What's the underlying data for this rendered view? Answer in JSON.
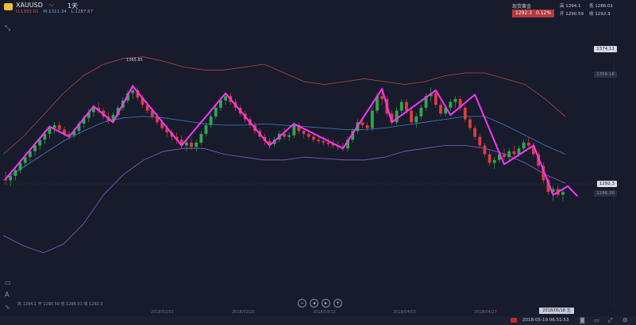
{
  "header": {
    "symbol": "XAUUSD",
    "period": "1天",
    "legend": {
      "upper": "U:1393.01",
      "middle": "M:1311.34",
      "lower": "L:1287.67"
    }
  },
  "quote": {
    "title": "现货黄金",
    "price": "1292.3",
    "change_pct": "0.12%",
    "high": "高 1294.1",
    "low": "低 1286.01",
    "open": "开 1290.59",
    "close": "收 1292.3"
  },
  "price_axis": {
    "level_top": "1374.11",
    "level_mid": "1358.16",
    "current": "1292.3",
    "current_low": "1286.36"
  },
  "peak_annotation": "1365.85",
  "bottom_info": "高 1294.1 开 1290.59 低 1286.01 收 1292.3",
  "x_axis": [
    "2018/02/01",
    "2018/02/20",
    "2018/03/13",
    "2018/04/03",
    "2018/04/27"
  ],
  "cursor_date": "2018/05/18 五",
  "status_time": "2018-05-19 06:51:53",
  "icons": {
    "settings_tool": "crosshair-expand-icon",
    "ruler": "ruler-icon",
    "text": "text-annotation-icon",
    "wave": "wave-icon",
    "zoom_out": "zoom-out-icon",
    "prev": "step-back-icon",
    "next": "step-forward-icon",
    "zoom_in": "zoom-in-icon"
  },
  "colors": {
    "up": "#2fa84f",
    "down": "#d93f3f",
    "boll_upper": "#b04a4a",
    "boll_mid": "#3f7fd0",
    "boll_lower": "#8a5cd6",
    "zigzag": "#ff33ff",
    "background": "#171b2b"
  },
  "chart_data": {
    "type": "candlestick",
    "title": "",
    "ylim": [
      1244,
      1386
    ],
    "x_range_dates": [
      "2018/01/03",
      "2018/05/18"
    ],
    "candles": [
      [
        1301,
        1306,
        1297,
        1300
      ],
      [
        1300,
        1305,
        1296,
        1303
      ],
      [
        1303,
        1309,
        1300,
        1307
      ],
      [
        1307,
        1314,
        1305,
        1312
      ],
      [
        1312,
        1318,
        1309,
        1316
      ],
      [
        1316,
        1322,
        1313,
        1320
      ],
      [
        1320,
        1326,
        1317,
        1324
      ],
      [
        1324,
        1330,
        1321,
        1328
      ],
      [
        1328,
        1334,
        1325,
        1332
      ],
      [
        1332,
        1338,
        1329,
        1336
      ],
      [
        1336,
        1340,
        1332,
        1338
      ],
      [
        1338,
        1340,
        1333,
        1335
      ],
      [
        1335,
        1337,
        1330,
        1332
      ],
      [
        1332,
        1334,
        1328,
        1331
      ],
      [
        1331,
        1336,
        1329,
        1334
      ],
      [
        1334,
        1341,
        1332,
        1339
      ],
      [
        1339,
        1345,
        1336,
        1343
      ],
      [
        1343,
        1349,
        1340,
        1347
      ],
      [
        1347,
        1352,
        1344,
        1350
      ],
      [
        1350,
        1354,
        1346,
        1348
      ],
      [
        1348,
        1350,
        1342,
        1344
      ],
      [
        1344,
        1347,
        1339,
        1341
      ],
      [
        1341,
        1347,
        1339,
        1345
      ],
      [
        1345,
        1352,
        1343,
        1350
      ],
      [
        1350,
        1357,
        1348,
        1355
      ],
      [
        1355,
        1362,
        1353,
        1360
      ],
      [
        1360,
        1366,
        1356,
        1362
      ],
      [
        1362,
        1364,
        1355,
        1357
      ],
      [
        1357,
        1359,
        1350,
        1352
      ],
      [
        1352,
        1354,
        1346,
        1348
      ],
      [
        1348,
        1350,
        1342,
        1344
      ],
      [
        1344,
        1346,
        1338,
        1340
      ],
      [
        1340,
        1342,
        1334,
        1336
      ],
      [
        1336,
        1338,
        1330,
        1333
      ],
      [
        1333,
        1335,
        1327,
        1330
      ],
      [
        1330,
        1333,
        1325,
        1328
      ],
      [
        1328,
        1331,
        1322,
        1324
      ],
      [
        1324,
        1328,
        1320,
        1326
      ],
      [
        1326,
        1329,
        1321,
        1323
      ],
      [
        1323,
        1328,
        1320,
        1326
      ],
      [
        1326,
        1334,
        1324,
        1332
      ],
      [
        1332,
        1340,
        1330,
        1338
      ],
      [
        1338,
        1346,
        1336,
        1344
      ],
      [
        1344,
        1352,
        1342,
        1350
      ],
      [
        1350,
        1357,
        1348,
        1355
      ],
      [
        1355,
        1360,
        1352,
        1358
      ],
      [
        1358,
        1360,
        1352,
        1354
      ],
      [
        1354,
        1356,
        1348,
        1350
      ],
      [
        1350,
        1352,
        1344,
        1346
      ],
      [
        1346,
        1348,
        1340,
        1342
      ],
      [
        1342,
        1344,
        1336,
        1338
      ],
      [
        1338,
        1340,
        1332,
        1334
      ],
      [
        1334,
        1336,
        1328,
        1330
      ],
      [
        1330,
        1332,
        1324,
        1327
      ],
      [
        1327,
        1329,
        1322,
        1325
      ],
      [
        1325,
        1330,
        1323,
        1328
      ],
      [
        1328,
        1334,
        1326,
        1332
      ],
      [
        1332,
        1336,
        1328,
        1330
      ],
      [
        1330,
        1333,
        1327,
        1331
      ],
      [
        1331,
        1340,
        1329,
        1338
      ],
      [
        1338,
        1340,
        1332,
        1334
      ],
      [
        1334,
        1336,
        1329,
        1332
      ],
      [
        1332,
        1335,
        1328,
        1330
      ],
      [
        1330,
        1333,
        1326,
        1328
      ],
      [
        1328,
        1331,
        1325,
        1327
      ],
      [
        1327,
        1330,
        1324,
        1326
      ],
      [
        1326,
        1329,
        1323,
        1325
      ],
      [
        1325,
        1328,
        1322,
        1324
      ],
      [
        1324,
        1327,
        1321,
        1323
      ],
      [
        1323,
        1326,
        1320,
        1322
      ],
      [
        1322,
        1330,
        1320,
        1328
      ],
      [
        1328,
        1336,
        1326,
        1334
      ],
      [
        1334,
        1342,
        1332,
        1340
      ],
      [
        1340,
        1342,
        1336,
        1338
      ],
      [
        1338,
        1340,
        1334,
        1336
      ],
      [
        1336,
        1350,
        1334,
        1348
      ],
      [
        1348,
        1360,
        1346,
        1358
      ],
      [
        1358,
        1364,
        1352,
        1356
      ],
      [
        1356,
        1358,
        1344,
        1346
      ],
      [
        1346,
        1348,
        1338,
        1340
      ],
      [
        1340,
        1350,
        1338,
        1348
      ],
      [
        1348,
        1356,
        1346,
        1354
      ],
      [
        1354,
        1356,
        1346,
        1348
      ],
      [
        1348,
        1350,
        1338,
        1340
      ],
      [
        1340,
        1346,
        1336,
        1344
      ],
      [
        1344,
        1352,
        1342,
        1350
      ],
      [
        1350,
        1360,
        1348,
        1358
      ],
      [
        1358,
        1364,
        1354,
        1360
      ],
      [
        1360,
        1362,
        1350,
        1352
      ],
      [
        1352,
        1354,
        1344,
        1346
      ],
      [
        1346,
        1352,
        1344,
        1350
      ],
      [
        1350,
        1356,
        1348,
        1354
      ],
      [
        1354,
        1358,
        1350,
        1356
      ],
      [
        1356,
        1358,
        1348,
        1350
      ],
      [
        1350,
        1352,
        1340,
        1342
      ],
      [
        1342,
        1344,
        1334,
        1336
      ],
      [
        1336,
        1338,
        1328,
        1330
      ],
      [
        1330,
        1332,
        1322,
        1324
      ],
      [
        1324,
        1326,
        1316,
        1318
      ],
      [
        1318,
        1320,
        1310,
        1312
      ],
      [
        1312,
        1316,
        1308,
        1314
      ],
      [
        1314,
        1320,
        1312,
        1318
      ],
      [
        1318,
        1322,
        1314,
        1316
      ],
      [
        1316,
        1322,
        1313,
        1320
      ],
      [
        1320,
        1324,
        1316,
        1318
      ],
      [
        1318,
        1324,
        1316,
        1322
      ],
      [
        1322,
        1328,
        1320,
        1326
      ],
      [
        1326,
        1330,
        1322,
        1324
      ],
      [
        1324,
        1326,
        1316,
        1318
      ],
      [
        1318,
        1320,
        1308,
        1310
      ],
      [
        1310,
        1312,
        1298,
        1300
      ],
      [
        1300,
        1302,
        1290,
        1292
      ],
      [
        1292,
        1296,
        1286,
        1294
      ],
      [
        1294,
        1297,
        1288,
        1290
      ],
      [
        1290,
        1294,
        1286,
        1292
      ]
    ],
    "bollinger": {
      "upper": [
        1318,
        1330,
        1345,
        1360,
        1372,
        1380,
        1384,
        1385,
        1382,
        1378,
        1376,
        1376,
        1378,
        1380,
        1374,
        1368,
        1366,
        1368,
        1370,
        1368,
        1366,
        1368,
        1372,
        1374,
        1374,
        1370,
        1366,
        1356,
        1344
      ],
      "middle": [
        1300,
        1309,
        1318,
        1327,
        1334,
        1340,
        1343,
        1344,
        1343,
        1341,
        1339,
        1338,
        1338,
        1339,
        1338,
        1337,
        1336,
        1335,
        1335,
        1336,
        1338,
        1340,
        1342,
        1344,
        1344,
        1338,
        1331,
        1324,
        1318
      ],
      "lower": [
        1262,
        1255,
        1250,
        1256,
        1270,
        1290,
        1304,
        1314,
        1320,
        1322,
        1322,
        1318,
        1316,
        1314,
        1314,
        1316,
        1315,
        1314,
        1314,
        1316,
        1320,
        1322,
        1324,
        1324,
        1322,
        1318,
        1312,
        1304,
        1298
      ]
    },
    "zigzag": [
      [
        0,
        1301
      ],
      [
        9,
        1337
      ],
      [
        13,
        1330
      ],
      [
        18,
        1351
      ],
      [
        22,
        1340
      ],
      [
        26,
        1365
      ],
      [
        36,
        1324
      ],
      [
        45,
        1360
      ],
      [
        54,
        1324
      ],
      [
        59,
        1339
      ],
      [
        69,
        1322
      ],
      [
        77,
        1363
      ],
      [
        79,
        1340
      ],
      [
        88,
        1362
      ],
      [
        91,
        1345
      ],
      [
        96,
        1359
      ],
      [
        102,
        1311
      ],
      [
        108,
        1324
      ],
      [
        112,
        1290
      ],
      [
        115,
        1296
      ],
      [
        117,
        1289
      ]
    ],
    "grid": false,
    "legend": "top-left"
  }
}
